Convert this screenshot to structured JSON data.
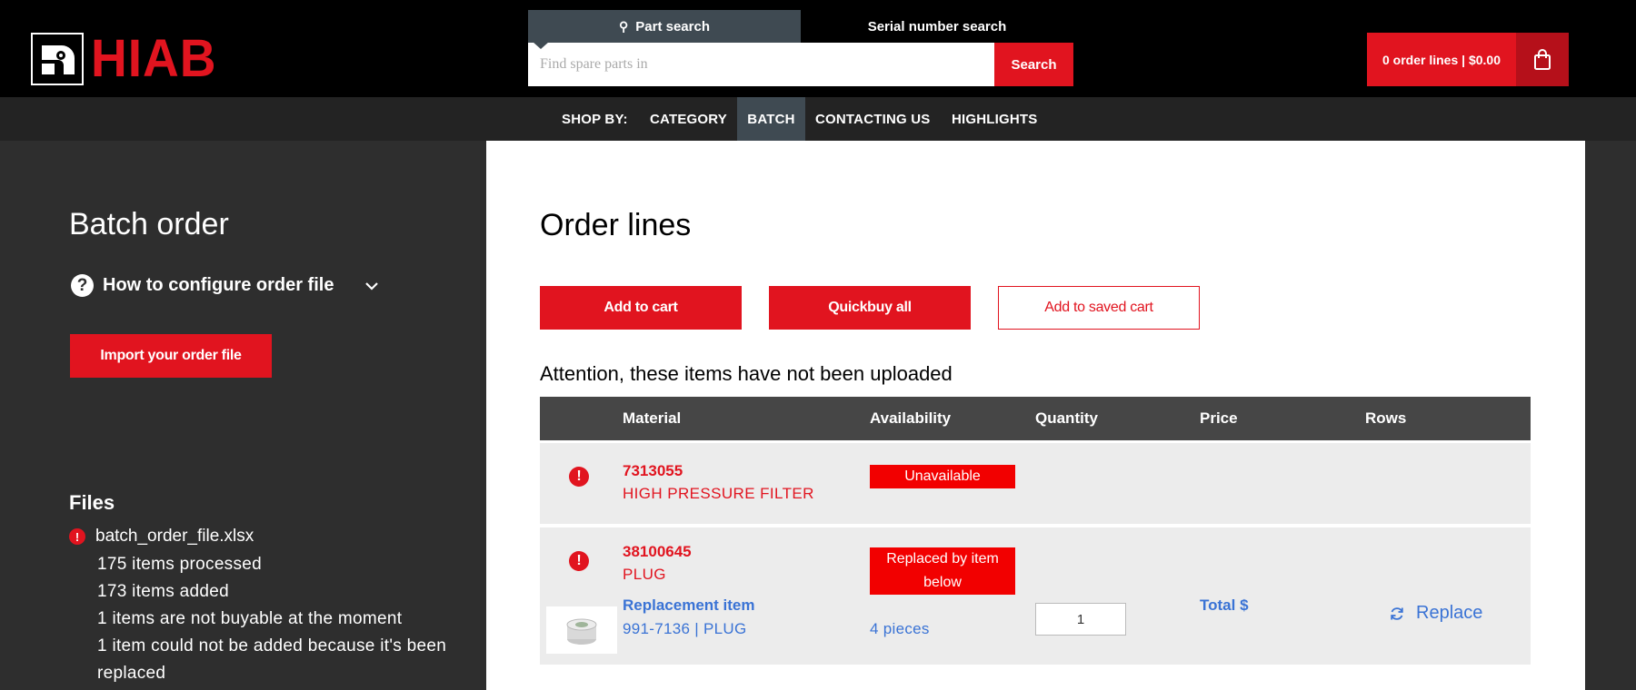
{
  "header": {
    "brand": "HIAB",
    "search_tabs": [
      {
        "label": "Part search",
        "active": true
      },
      {
        "label": "Serial number search",
        "active": false
      }
    ],
    "search_placeholder": "Find spare parts in",
    "search_button": "Search",
    "cart_label": "0 order lines | $0.00"
  },
  "nav": {
    "shop_by": "SHOP BY:",
    "items": [
      {
        "label": "CATEGORY",
        "active": false
      },
      {
        "label": "BATCH",
        "active": true
      },
      {
        "label": "CONTACTING US",
        "active": false
      },
      {
        "label": "HIGHLIGHTS",
        "active": false
      }
    ]
  },
  "sidebar": {
    "title": "Batch order",
    "howto_label": "How to configure order file",
    "import_button": "Import your order file",
    "files_title": "Files",
    "file_name": "batch_order_file.xlsx",
    "stats": [
      "175 items processed",
      "173 items added",
      "1 items are not buyable at the moment",
      "1 item could not be added because it's been replaced"
    ]
  },
  "main": {
    "title": "Order lines",
    "buttons": {
      "add_to_cart": "Add to cart",
      "quickbuy_all": "Quickbuy all",
      "add_to_saved_cart": "Add to saved cart"
    },
    "attention": "Attention, these items have not been uploaded",
    "table": {
      "headers": [
        "Material",
        "Availability",
        "Quantity",
        "Price",
        "Rows"
      ],
      "rows": [
        {
          "material_number": "7313055",
          "material_name": "HIGH PRESSURE FILTER",
          "availability": "Unavailable"
        },
        {
          "material_number": "38100645",
          "material_name": "PLUG",
          "availability": "Replaced by item below",
          "replacement_label": "Replacement item",
          "replacement_sub": "991-7136 | PLUG",
          "replacement_availability": "4 pieces",
          "quantity": "1",
          "price": "Total $",
          "action": "Replace"
        }
      ]
    }
  },
  "colors": {
    "brand_red": "#e1141f",
    "link_blue": "#3a73d5",
    "header_black": "#000000",
    "sidebar_gray": "#2e2e2e"
  }
}
